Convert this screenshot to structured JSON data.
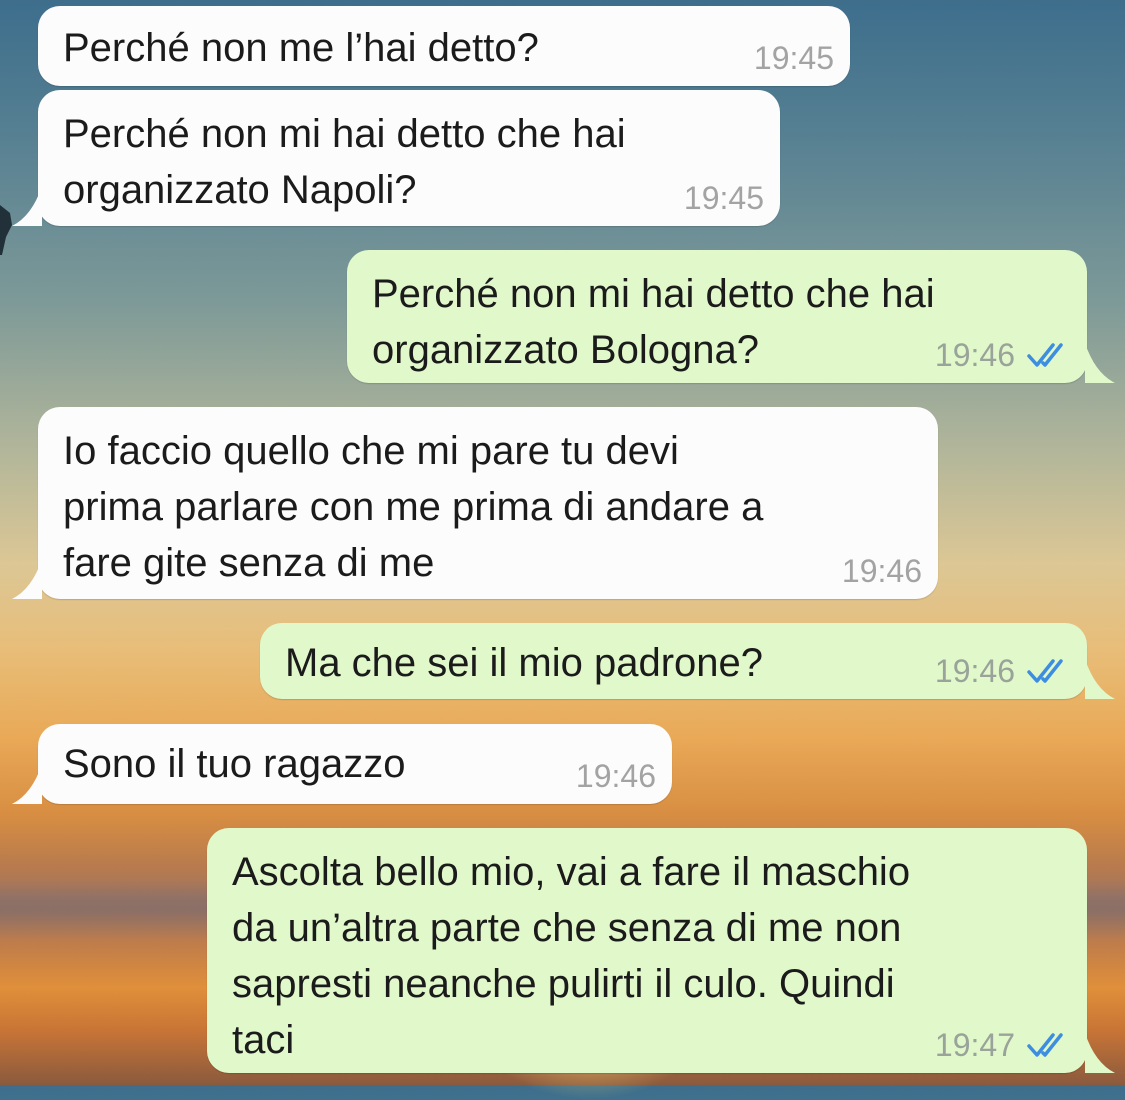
{
  "conversation": {
    "messages": [
      {
        "direction": "in",
        "text": "Perché non me l’hai detto?",
        "time": "19:45"
      },
      {
        "direction": "in",
        "text": "Perché non mi hai detto che hai\norganizzato Napoli?",
        "time": "19:45"
      },
      {
        "direction": "out",
        "text": "Perché non mi hai detto che hai\norganizzato Bologna?",
        "time": "19:46",
        "status_icon": "double-check-read-icon"
      },
      {
        "direction": "in",
        "text": "Io faccio quello che mi pare tu devi\nprima parlare con me prima di andare a\nfare gite senza di me",
        "time": "19:46"
      },
      {
        "direction": "out",
        "text": "Ma che sei il mio padrone?",
        "time": "19:46",
        "status_icon": "double-check-read-icon"
      },
      {
        "direction": "in",
        "text": "Sono il tuo ragazzo",
        "time": "19:46"
      },
      {
        "direction": "out",
        "text": "Ascolta bello mio, vai a fare il maschio\nda un’altra parte che senza di me non\nsapresti neanche pulirti il culo. Quindi\ntaci",
        "time": "19:47",
        "status_icon": "double-check-read-icon"
      }
    ]
  },
  "colors": {
    "incoming_bubble": "#fcfcfc",
    "outgoing_bubble": "#e1f8cb",
    "read_ticks": "#3d8ee0",
    "timestamp": "#9aa39a"
  }
}
